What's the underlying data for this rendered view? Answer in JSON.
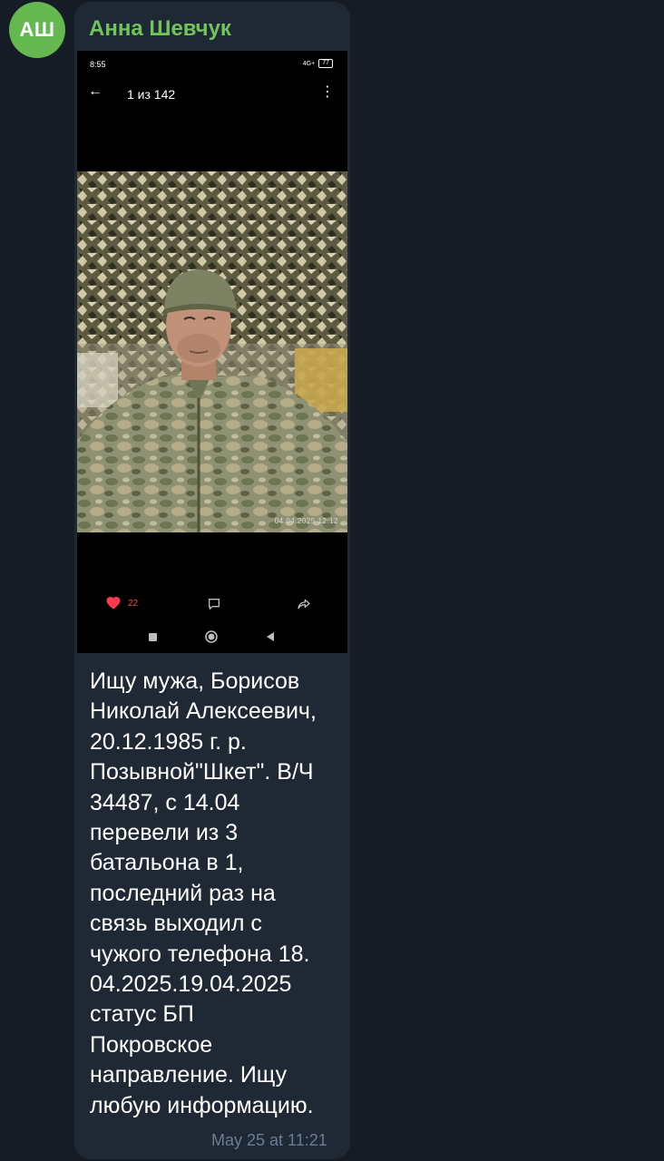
{
  "chat": {
    "avatar_initials": "АШ",
    "sender_name": "Анна Шевчук",
    "timestamp": "May 25 at 11:21",
    "message_text": "Ищу мужа, Борисов\nНиколай Алексеевич,\n20.12.1985 г. р.\nПозывной\"Шкет\". В/Ч\n34487, с 14.04\nперевели из 3\nбатальона в 1,\nпоследний раз на\nсвязь выходил с\nчужого телефона 18.\n04.2025.19.04.2025\nстатус БП\nПокровское\nнаправление. Ищу\nлюбую информацию."
  },
  "screenshot": {
    "status_time": "8:55",
    "status_network": "4G+",
    "battery": "77",
    "photo_counter": "1 из 142",
    "photo_date": "04.04.2025 12:12",
    "like_count": "22",
    "colors": {
      "like": "#ff3a4e"
    }
  },
  "colors": {
    "background": "#161c25",
    "bubble": "#1f2935",
    "sender": "#72c35b",
    "avatar": "#64b84f",
    "timestamp": "#6a7d93"
  },
  "icons": [
    "back-arrow-icon",
    "more-vertical-icon",
    "heart-icon",
    "comment-icon",
    "share-icon",
    "nav-recents-icon",
    "nav-home-icon",
    "nav-back-icon"
  ]
}
